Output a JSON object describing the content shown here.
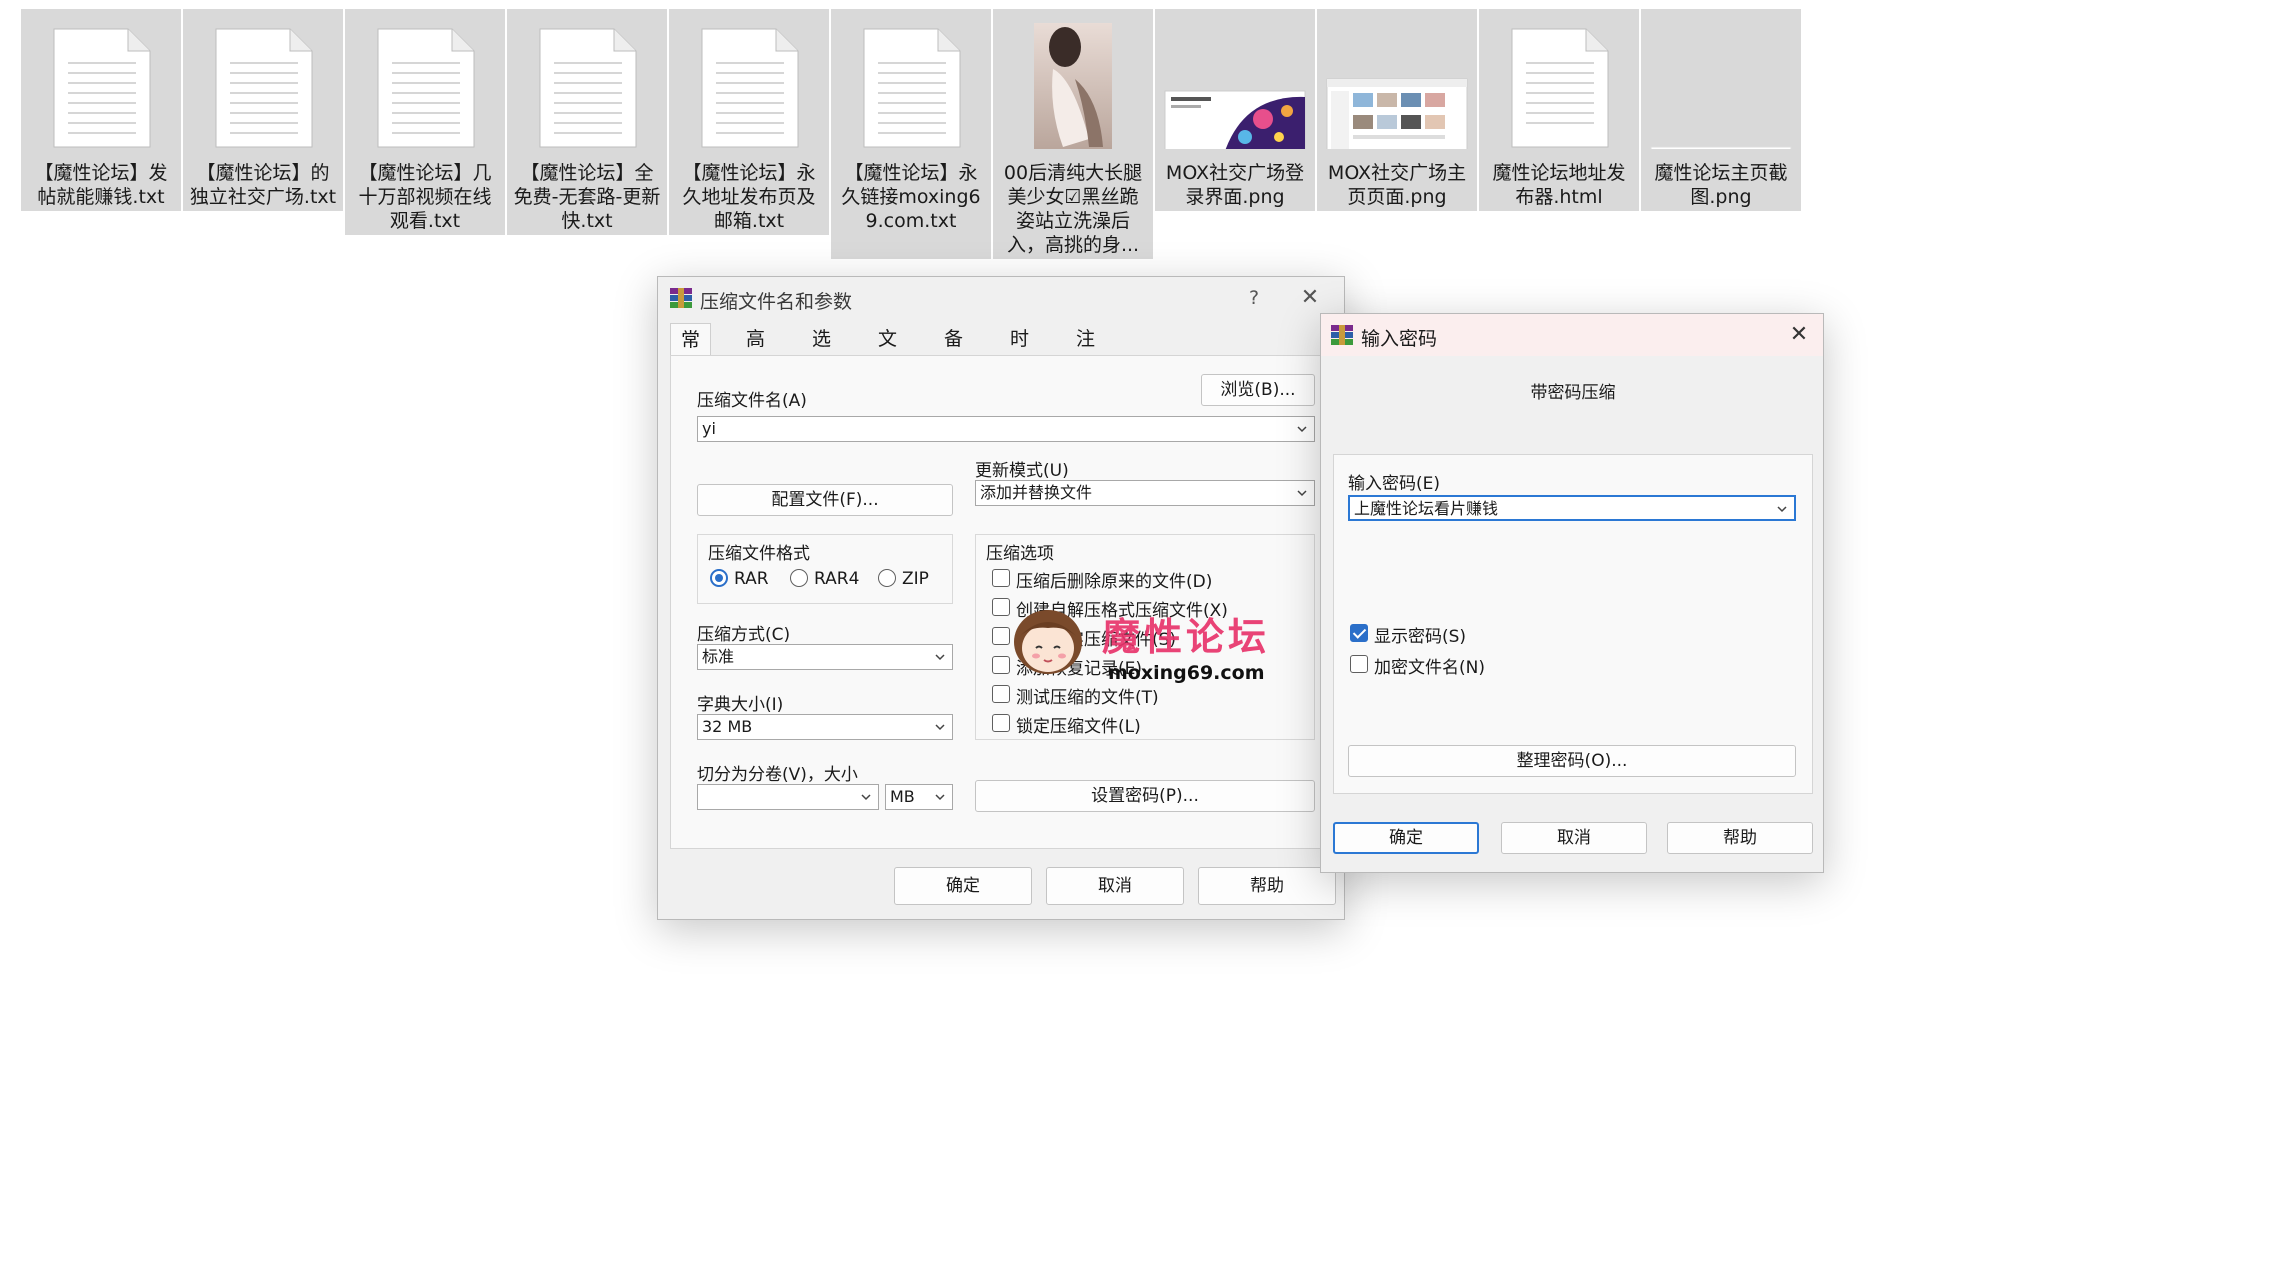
{
  "files": [
    {
      "name": "【魔性论坛】发帖就能赚钱.txt",
      "icon": "text-file-icon"
    },
    {
      "name": "【魔性论坛】的独立社交广场.txt",
      "icon": "text-file-icon"
    },
    {
      "name": "【魔性论坛】几十万部视频在线观看.txt",
      "icon": "text-file-icon"
    },
    {
      "name": "【魔性论坛】全免费-无套路-更新快.txt",
      "icon": "text-file-icon"
    },
    {
      "name": "【魔性论坛】永久地址发布页及邮箱.txt",
      "icon": "text-file-icon"
    },
    {
      "name": "【魔性论坛】永久链接moxing69.com.txt",
      "icon": "text-file-icon"
    },
    {
      "name": "00后清纯大长腿美少女☑黑丝跪姿站立洗澡后入，高挑的身...",
      "icon": "photo-thumbnail"
    },
    {
      "name": "MOX社交广场登录界面.png",
      "icon": "image-thumbnail"
    },
    {
      "name": "MOX社交广场主页页面.png",
      "icon": "image-thumbnail"
    },
    {
      "name": "魔性论坛地址发布器.html",
      "icon": "html-file-icon"
    },
    {
      "name": "魔性论坛主页截图.png",
      "icon": "image-thumbnail"
    }
  ],
  "archive_dialog": {
    "title": "压缩文件名和参数",
    "help_glyph": "?",
    "close_glyph": "✕",
    "tabs": [
      "常规",
      "高级",
      "选项",
      "文件",
      "备份",
      "时间",
      "注释"
    ],
    "archive_name_label": "压缩文件名(A)",
    "browse_button": "浏览(B)...",
    "archive_name_value": "yi",
    "update_mode_label": "更新模式(U)",
    "update_mode_value": "添加并替换文件",
    "profiles_button": "配置文件(F)...",
    "format_group_label": "压缩文件格式",
    "formats": [
      {
        "label": "RAR",
        "selected": true
      },
      {
        "label": "RAR4",
        "selected": false
      },
      {
        "label": "ZIP",
        "selected": false
      }
    ],
    "options_group_label": "压缩选项",
    "options": [
      "压缩后删除原来的文件(D)",
      "创建自解压格式压缩文件(X)",
      "创建固实压缩文件(S)",
      "添加恢复记录(E)",
      "测试压缩的文件(T)",
      "锁定压缩文件(L)"
    ],
    "method_label": "压缩方式(C)",
    "method_value": "标准",
    "dict_label": "字典大小(I)",
    "dict_value": "32 MB",
    "split_label": "切分为分卷(V)，大小",
    "split_value": "",
    "split_unit": "MB",
    "set_password_button": "设置密码(P)...",
    "ok": "确定",
    "cancel": "取消",
    "help": "帮助"
  },
  "password_dialog": {
    "title": "输入密码",
    "close_glyph": "✕",
    "subtitle": "带密码压缩",
    "password_label": "输入密码(E)",
    "password_value": "上魔性论坛看片赚钱",
    "show_password": "显示密码(S)",
    "show_password_checked": true,
    "encrypt_names": "加密文件名(N)",
    "encrypt_names_checked": false,
    "organize_button": "整理密码(O)...",
    "ok": "确定",
    "cancel": "取消",
    "help": "帮助"
  },
  "watermark": {
    "text": "魔性论坛",
    "url": "moxing69.com"
  },
  "colors": {
    "accent": "#2b6fc9",
    "tile_bg": "#d9d9d9",
    "watermark": "#e8346b"
  }
}
